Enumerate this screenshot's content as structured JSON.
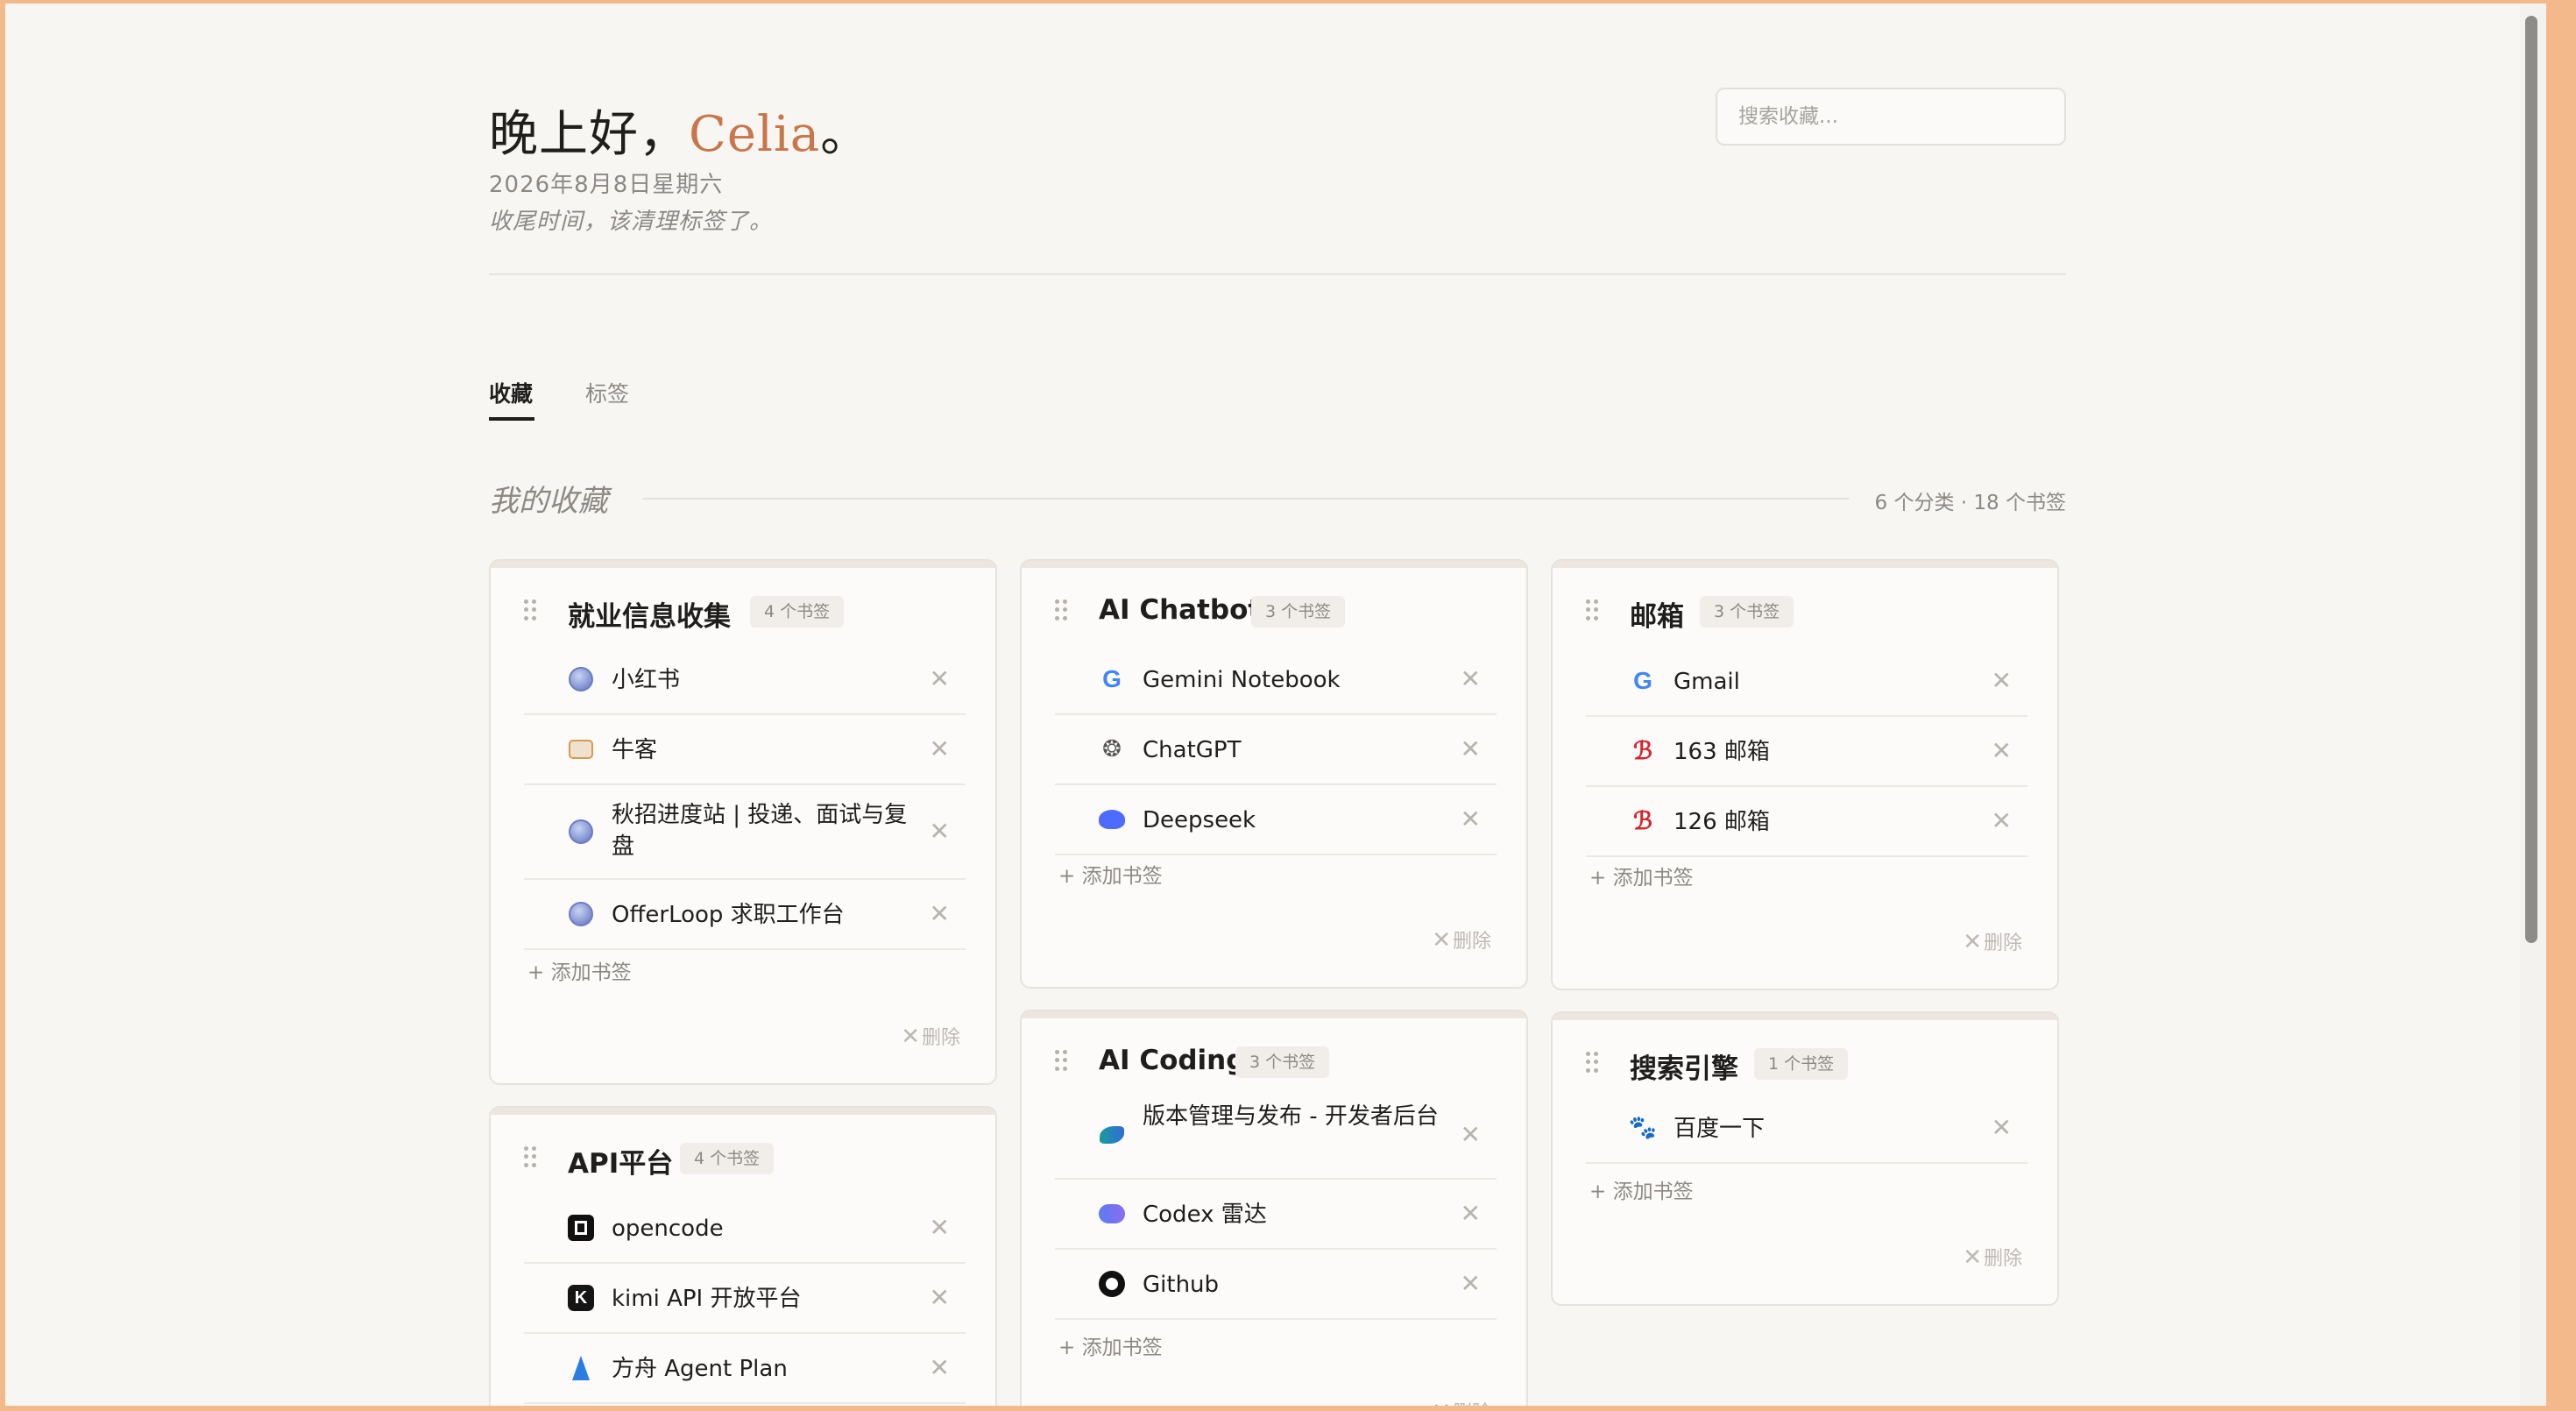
{
  "header": {
    "greeting_prefix": "晚上好，",
    "greeting_name": "Celia",
    "greeting_suffix": "。",
    "date": "2026年8月8日星期六",
    "subtitle": "收尾时间，该清理标签了。",
    "search_placeholder": "搜索收藏..."
  },
  "tabs": [
    {
      "label": "收藏",
      "active": true
    },
    {
      "label": "标签",
      "active": false
    }
  ],
  "section": {
    "title": "我的收藏",
    "count": "6 个分类 · 18 个书签"
  },
  "labels": {
    "add_bookmark": "+ 添加书签",
    "delete": "删除",
    "remove_icon": "✕"
  },
  "categories": [
    {
      "title": "就业信息收集",
      "badge": "4 个书签",
      "bookmarks": [
        {
          "label": "小红书",
          "icon": "globe-icon"
        },
        {
          "label": "牛客",
          "icon": "nowcoder-icon"
        },
        {
          "label": "秋招进度站 | 投递、面试与复盘",
          "icon": "globe-icon"
        },
        {
          "label": "OfferLoop 求职工作台",
          "icon": "globe-icon"
        }
      ]
    },
    {
      "title": "AI Chatbot",
      "badge": "3 个书签",
      "bookmarks": [
        {
          "label": "Gemini Notebook",
          "icon": "google-icon"
        },
        {
          "label": "ChatGPT",
          "icon": "openai-icon"
        },
        {
          "label": "Deepseek",
          "icon": "deepseek-icon"
        }
      ]
    },
    {
      "title": "邮箱",
      "badge": "3 个书签",
      "bookmarks": [
        {
          "label": "Gmail",
          "icon": "google-icon"
        },
        {
          "label": "163 邮箱",
          "icon": "netease-icon"
        },
        {
          "label": "126 邮箱",
          "icon": "netease-icon"
        }
      ]
    },
    {
      "title": "API平台",
      "badge": "4 个书签",
      "bookmarks": [
        {
          "label": "opencode",
          "icon": "opencode-icon"
        },
        {
          "label": "kimi API 开放平台",
          "icon": "kimi-icon"
        },
        {
          "label": "方舟 Agent Plan",
          "icon": "volcengine-icon"
        }
      ]
    },
    {
      "title": "AI Coding",
      "badge": "3 个书签",
      "bookmarks": [
        {
          "label": "版本管理与发布 - 开发者后台",
          "icon": "devconsole-icon"
        },
        {
          "label": "Codex 雷达",
          "icon": "cloud-icon"
        },
        {
          "label": "Github",
          "icon": "github-icon"
        }
      ]
    },
    {
      "title": "搜索引擎",
      "badge": "1 个书签",
      "bookmarks": [
        {
          "label": "百度一下",
          "icon": "baidu-icon"
        }
      ]
    }
  ],
  "colors": {
    "accent": "#c8764a",
    "background": "#f7f6f3",
    "card": "#fcfbf9",
    "text": "#1f1e1c",
    "muted": "#8c8985"
  }
}
